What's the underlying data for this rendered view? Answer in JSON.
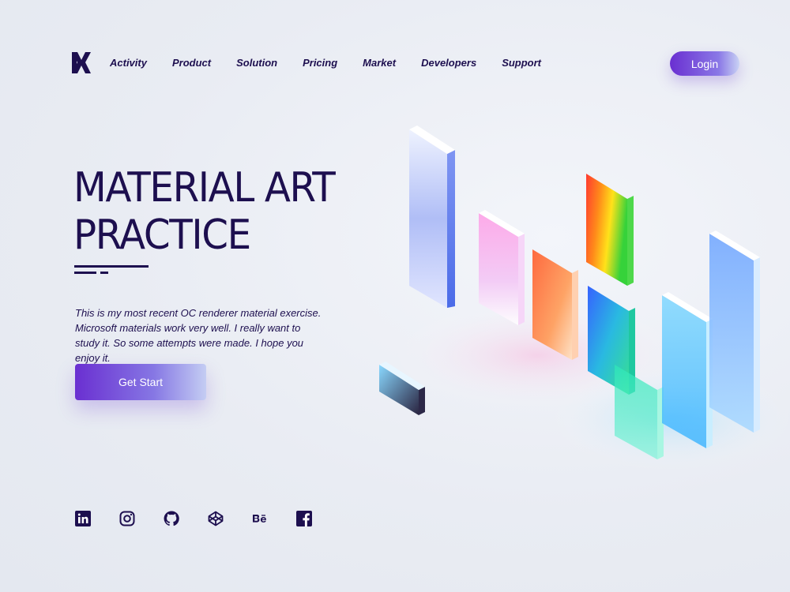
{
  "brand": {
    "logo_icon": "brand-logo-icon"
  },
  "nav": {
    "items": [
      {
        "label": "Activity"
      },
      {
        "label": "Product"
      },
      {
        "label": "Solution"
      },
      {
        "label": "Pricing"
      },
      {
        "label": "Market"
      },
      {
        "label": "Developers"
      },
      {
        "label": "Support"
      }
    ],
    "login_label": "Login"
  },
  "hero": {
    "title_line1": "MATERIAL ART",
    "title_line2": "PRACTICE",
    "description": "This is my most recent OC renderer material exercise. Microsoft materials work very well. I really want to study it. So some attempts were made. I hope you enjoy it.",
    "cta_label": "Get Start"
  },
  "socials": [
    {
      "icon": "linkedin-icon"
    },
    {
      "icon": "instagram-icon"
    },
    {
      "icon": "github-icon"
    },
    {
      "icon": "codepen-icon"
    },
    {
      "icon": "behance-icon"
    },
    {
      "icon": "facebook-icon"
    }
  ],
  "colors": {
    "primary_text": "#1d0f4f",
    "accent": "#6a2fd1",
    "background": "#e9ecf3"
  }
}
